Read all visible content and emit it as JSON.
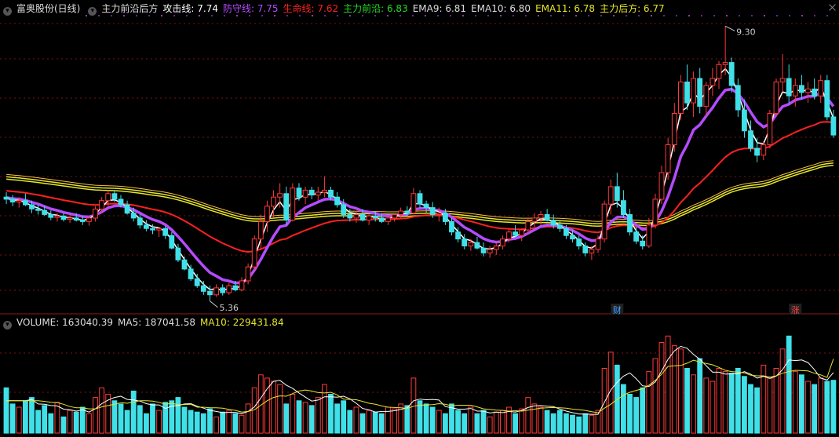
{
  "header": {
    "stock": "富奥股份(日线)",
    "indicator_name": "主力前沿后方",
    "lines": [
      {
        "label": "攻击线: ",
        "value": "7.74",
        "color": "#ffffff"
      },
      {
        "label": "防守线: ",
        "value": "7.75",
        "color": "#b44cff"
      },
      {
        "label": "生命线: ",
        "value": "7.62",
        "color": "#ff2020"
      },
      {
        "label": "主力前沿: ",
        "value": "6.83",
        "color": "#22dd22"
      },
      {
        "label": "EMA9: ",
        "value": "6.81",
        "color": "#dddddd"
      },
      {
        "label": "EMA10: ",
        "value": "6.80",
        "color": "#dddddd"
      },
      {
        "label": "EMA11: ",
        "value": "6.78",
        "color": "#e6e62e"
      },
      {
        "label": "主力后方: ",
        "value": "6.77",
        "color": "#e6e62e"
      }
    ]
  },
  "volume_header": {
    "volume_label": "VOLUME: ",
    "volume_value": "163040.39",
    "ma5_label": "MA5: ",
    "ma5_value": "187041.58",
    "ma10_label": "MA10: ",
    "ma10_value": "229431.84"
  },
  "annotations": {
    "high": "9.30",
    "low": "5.36",
    "marker_cai": "财",
    "marker_zhang": "涨"
  },
  "colors": {
    "up": "#ff3a3a",
    "down": "#40e0e8",
    "attack": "#ffffff",
    "defense": "#b44cff",
    "life": "#ff2020",
    "rear": "#e6e62e",
    "grid": "#7a1414"
  },
  "chart_data": {
    "type": "candlestick",
    "ylim": [
      5.2,
      9.45
    ],
    "high": 9.3,
    "low": 5.36,
    "candles": [
      [
        6.85,
        6.92,
        6.75,
        6.82
      ],
      [
        6.82,
        6.88,
        6.72,
        6.78
      ],
      [
        6.78,
        6.85,
        6.7,
        6.8
      ],
      [
        6.8,
        6.9,
        6.72,
        6.74
      ],
      [
        6.74,
        6.8,
        6.62,
        6.68
      ],
      [
        6.68,
        6.74,
        6.6,
        6.66
      ],
      [
        6.66,
        6.72,
        6.58,
        6.6
      ],
      [
        6.6,
        6.66,
        6.52,
        6.56
      ],
      [
        6.56,
        6.62,
        6.5,
        6.58
      ],
      [
        6.58,
        6.62,
        6.5,
        6.53
      ],
      [
        6.53,
        6.6,
        6.48,
        6.55
      ],
      [
        6.55,
        6.62,
        6.5,
        6.52
      ],
      [
        6.52,
        6.58,
        6.45,
        6.5
      ],
      [
        6.5,
        6.58,
        6.44,
        6.55
      ],
      [
        6.55,
        6.72,
        6.5,
        6.68
      ],
      [
        6.68,
        6.85,
        6.62,
        6.8
      ],
      [
        6.8,
        6.95,
        6.72,
        6.9
      ],
      [
        6.9,
        6.95,
        6.78,
        6.82
      ],
      [
        6.82,
        6.88,
        6.7,
        6.74
      ],
      [
        6.74,
        6.8,
        6.6,
        6.62
      ],
      [
        6.62,
        6.7,
        6.5,
        6.55
      ],
      [
        6.55,
        6.6,
        6.4,
        6.45
      ],
      [
        6.45,
        6.52,
        6.36,
        6.4
      ],
      [
        6.4,
        6.46,
        6.32,
        6.38
      ],
      [
        6.38,
        6.42,
        6.28,
        6.4
      ],
      [
        6.4,
        6.44,
        6.25,
        6.3
      ],
      [
        6.3,
        6.35,
        6.1,
        6.12
      ],
      [
        6.12,
        6.18,
        5.92,
        5.95
      ],
      [
        5.95,
        6.0,
        5.8,
        5.82
      ],
      [
        5.82,
        5.88,
        5.65,
        5.68
      ],
      [
        5.68,
        5.75,
        5.55,
        5.58
      ],
      [
        5.58,
        5.65,
        5.45,
        5.5
      ],
      [
        5.5,
        5.58,
        5.36,
        5.45
      ],
      [
        5.45,
        5.6,
        5.42,
        5.55
      ],
      [
        5.55,
        5.6,
        5.44,
        5.48
      ],
      [
        5.48,
        5.62,
        5.45,
        5.58
      ],
      [
        5.58,
        5.65,
        5.5,
        5.52
      ],
      [
        5.52,
        5.7,
        5.5,
        5.65
      ],
      [
        5.65,
        5.9,
        5.6,
        5.85
      ],
      [
        5.85,
        6.3,
        5.8,
        6.25
      ],
      [
        6.25,
        6.6,
        6.1,
        6.5
      ],
      [
        6.5,
        6.8,
        6.35,
        6.72
      ],
      [
        6.72,
        6.95,
        6.55,
        6.85
      ],
      [
        6.85,
        7.05,
        6.7,
        6.9
      ],
      [
        6.9,
        7.0,
        6.45,
        6.52
      ],
      [
        6.52,
        7.05,
        6.5,
        6.98
      ],
      [
        6.98,
        7.05,
        6.8,
        6.85
      ],
      [
        6.85,
        7.0,
        6.75,
        6.95
      ],
      [
        6.95,
        7.0,
        6.82,
        6.88
      ],
      [
        6.88,
        7.0,
        6.8,
        6.92
      ],
      [
        6.92,
        7.15,
        6.85,
        6.95
      ],
      [
        6.95,
        7.0,
        6.8,
        6.85
      ],
      [
        6.85,
        6.92,
        6.7,
        6.74
      ],
      [
        6.74,
        6.82,
        6.55,
        6.6
      ],
      [
        6.6,
        6.68,
        6.5,
        6.55
      ],
      [
        6.55,
        6.65,
        6.48,
        6.6
      ],
      [
        6.6,
        6.68,
        6.5,
        6.52
      ],
      [
        6.52,
        6.6,
        6.45,
        6.58
      ],
      [
        6.58,
        6.65,
        6.5,
        6.55
      ],
      [
        6.55,
        6.62,
        6.48,
        6.5
      ],
      [
        6.5,
        6.58,
        6.45,
        6.55
      ],
      [
        6.55,
        6.62,
        6.5,
        6.6
      ],
      [
        6.6,
        6.7,
        6.55,
        6.65
      ],
      [
        6.65,
        6.72,
        6.58,
        6.62
      ],
      [
        6.62,
        6.98,
        6.6,
        6.9
      ],
      [
        6.9,
        6.95,
        6.7,
        6.75
      ],
      [
        6.75,
        6.8,
        6.62,
        6.7
      ],
      [
        6.7,
        6.78,
        6.55,
        6.6
      ],
      [
        6.6,
        6.7,
        6.5,
        6.62
      ],
      [
        6.62,
        6.68,
        6.45,
        6.5
      ],
      [
        6.5,
        6.55,
        6.3,
        6.35
      ],
      [
        6.35,
        6.42,
        6.2,
        6.25
      ],
      [
        6.25,
        6.32,
        6.1,
        6.15
      ],
      [
        6.15,
        6.25,
        6.08,
        6.2
      ],
      [
        6.2,
        6.28,
        6.1,
        6.12
      ],
      [
        6.12,
        6.2,
        6.0,
        6.05
      ],
      [
        6.05,
        6.15,
        5.98,
        6.1
      ],
      [
        6.1,
        6.2,
        6.02,
        6.15
      ],
      [
        6.15,
        6.3,
        6.1,
        6.25
      ],
      [
        6.25,
        6.4,
        6.2,
        6.35
      ],
      [
        6.35,
        6.45,
        6.28,
        6.3
      ],
      [
        6.3,
        6.4,
        6.22,
        6.38
      ],
      [
        6.38,
        6.55,
        6.32,
        6.5
      ],
      [
        6.5,
        6.62,
        6.42,
        6.55
      ],
      [
        6.55,
        6.65,
        6.45,
        6.6
      ],
      [
        6.6,
        6.68,
        6.5,
        6.52
      ],
      [
        6.52,
        6.6,
        6.4,
        6.45
      ],
      [
        6.45,
        6.52,
        6.35,
        6.4
      ],
      [
        6.4,
        6.45,
        6.25,
        6.3
      ],
      [
        6.3,
        6.38,
        6.2,
        6.25
      ],
      [
        6.25,
        6.3,
        6.1,
        6.15
      ],
      [
        6.15,
        6.2,
        6.0,
        6.05
      ],
      [
        6.05,
        6.15,
        5.95,
        6.1
      ],
      [
        6.1,
        6.3,
        6.05,
        6.25
      ],
      [
        6.25,
        6.8,
        6.2,
        6.75
      ],
      [
        6.75,
        7.1,
        6.6,
        7.0
      ],
      [
        7.0,
        7.2,
        6.7,
        6.8
      ],
      [
        6.8,
        6.95,
        6.55,
        6.6
      ],
      [
        6.6,
        6.68,
        6.3,
        6.35
      ],
      [
        6.35,
        6.42,
        6.18,
        6.22
      ],
      [
        6.22,
        6.3,
        6.1,
        6.15
      ],
      [
        6.15,
        6.55,
        6.12,
        6.45
      ],
      [
        6.45,
        6.9,
        6.4,
        6.82
      ],
      [
        6.82,
        7.3,
        6.75,
        7.2
      ],
      [
        7.2,
        7.7,
        7.1,
        7.6
      ],
      [
        7.6,
        8.2,
        7.5,
        8.05
      ],
      [
        8.05,
        8.6,
        7.95,
        8.5
      ],
      [
        8.5,
        8.75,
        8.1,
        8.2
      ],
      [
        8.2,
        8.65,
        8.0,
        8.55
      ],
      [
        8.55,
        8.7,
        8.05,
        8.15
      ],
      [
        8.15,
        8.5,
        8.0,
        8.45
      ],
      [
        8.45,
        8.7,
        8.3,
        8.55
      ],
      [
        8.55,
        8.8,
        8.4,
        8.75
      ],
      [
        8.75,
        9.3,
        8.6,
        8.78
      ],
      [
        8.78,
        8.85,
        8.35,
        8.45
      ],
      [
        8.45,
        8.55,
        8.0,
        8.1
      ],
      [
        8.1,
        8.25,
        7.7,
        7.8
      ],
      [
        7.8,
        7.95,
        7.5,
        7.55
      ],
      [
        7.55,
        7.7,
        7.35,
        7.45
      ],
      [
        7.45,
        7.65,
        7.38,
        7.6
      ],
      [
        7.6,
        8.1,
        7.55,
        8.05
      ],
      [
        8.05,
        8.55,
        8.0,
        8.5
      ],
      [
        8.5,
        8.9,
        8.35,
        8.55
      ],
      [
        8.55,
        8.75,
        8.2,
        8.3
      ],
      [
        8.3,
        8.55,
        8.15,
        8.45
      ],
      [
        8.45,
        8.6,
        8.25,
        8.35
      ],
      [
        8.35,
        8.5,
        8.2,
        8.4
      ],
      [
        8.4,
        8.55,
        8.25,
        8.3
      ],
      [
        8.3,
        8.6,
        8.2,
        8.52
      ],
      [
        8.52,
        8.6,
        7.95,
        8.0
      ],
      [
        8.0,
        8.1,
        7.7,
        7.74
      ]
    ],
    "volume": {
      "ylim": [
        0,
        320000
      ],
      "values": [
        140000,
        90000,
        80000,
        100000,
        110000,
        70000,
        85000,
        60000,
        95000,
        50000,
        70000,
        65000,
        80000,
        60000,
        110000,
        140000,
        120000,
        100000,
        90000,
        70000,
        130000,
        85000,
        60000,
        90000,
        70000,
        95000,
        100000,
        110000,
        80000,
        70000,
        65000,
        60000,
        75000,
        50000,
        65000,
        70000,
        60000,
        55000,
        90000,
        140000,
        180000,
        170000,
        160000,
        150000,
        90000,
        120000,
        100000,
        95000,
        85000,
        110000,
        150000,
        120000,
        90000,
        100000,
        70000,
        80000,
        60000,
        70000,
        65000,
        60000,
        80000,
        75000,
        90000,
        85000,
        170000,
        100000,
        90000,
        80000,
        70000,
        60000,
        90000,
        70000,
        60000,
        80000,
        60000,
        70000,
        50000,
        65000,
        70000,
        80000,
        60000,
        75000,
        110000,
        90000,
        80000,
        70000,
        60000,
        70000,
        60000,
        55000,
        50000,
        60000,
        55000,
        70000,
        200000,
        250000,
        210000,
        150000,
        120000,
        110000,
        140000,
        190000,
        230000,
        280000,
        300000,
        270000,
        260000,
        200000,
        180000,
        230000,
        170000,
        160000,
        200000,
        190000,
        185000,
        200000,
        175000,
        150000,
        140000,
        210000,
        170000,
        200000,
        260000,
        300000,
        190000,
        180000,
        160000,
        150000,
        170000,
        160000,
        163040
      ],
      "ma5": [
        100000,
        100000,
        100000,
        100000,
        104000,
        90000,
        89000,
        85000,
        84000,
        74000,
        72000,
        68000,
        72000,
        65000,
        75000,
        91000,
        102000,
        110000,
        114000,
        104000,
        102000,
        99000,
        91000,
        87000,
        87000,
        76000,
        83000,
        85000,
        90000,
        91000,
        83000,
        77000,
        70000,
        67000,
        63000,
        64000,
        64000,
        60000,
        67000,
        81000,
        108000,
        137000,
        160000,
        163000,
        148000,
        138000,
        124000,
        111000,
        99000,
        102000,
        112000,
        112000,
        111000,
        114000,
        106000,
        92000,
        76000,
        72000,
        65000,
        67000,
        67000,
        69000,
        73000,
        78000,
        100000,
        105000,
        103000,
        104000,
        102000,
        82000,
        78000,
        74000,
        74000,
        76000,
        68000,
        68000,
        62000,
        65000,
        63000,
        67000,
        65000,
        70000,
        79000,
        84000,
        85000,
        83000,
        82000,
        74000,
        68000,
        63000,
        59000,
        59000,
        58000,
        58000,
        95000,
        133000,
        157000,
        176000,
        186000,
        168000,
        146000,
        144000,
        158000,
        192000,
        228000,
        254000,
        268000,
        262000,
        243000,
        228000,
        208000,
        188000,
        188000,
        182000,
        183000,
        183000,
        190000,
        182000,
        170000,
        175000,
        169000,
        176000,
        196000,
        226000,
        224000,
        226000,
        218000,
        196000,
        170000,
        164000,
        187042
      ],
      "ma10": [
        100000,
        100000,
        100000,
        100000,
        100000,
        100000,
        98000,
        95000,
        94000,
        89000,
        82000,
        78000,
        78000,
        75000,
        75000,
        81000,
        85000,
        89000,
        94000,
        92000,
        96000,
        100000,
        100000,
        99000,
        95000,
        89000,
        92000,
        88000,
        88000,
        89000,
        80000,
        80000,
        78000,
        78000,
        77000,
        73000,
        70000,
        65000,
        67000,
        72000,
        86000,
        100000,
        110000,
        115000,
        114000,
        122000,
        130000,
        133000,
        130000,
        125000,
        124000,
        126000,
        118000,
        105000,
        104000,
        103000,
        98000,
        92000,
        89000,
        84000,
        80000,
        79000,
        78000,
        76000,
        83000,
        86000,
        87000,
        88000,
        91000,
        89000,
        84000,
        86000,
        86000,
        86000,
        81000,
        75000,
        73000,
        71000,
        70000,
        68000,
        69000,
        68000,
        71000,
        74000,
        77000,
        78000,
        79000,
        78000,
        77000,
        74000,
        72000,
        70000,
        66000,
        63000,
        77000,
        89000,
        104000,
        117000,
        126000,
        132000,
        137000,
        148000,
        163000,
        182000,
        206000,
        208000,
        209000,
        216000,
        225000,
        220000,
        215000,
        211000,
        203000,
        194000,
        190000,
        188000,
        186000,
        179000,
        177000,
        177000,
        173000,
        177000,
        185000,
        190000,
        194000,
        193000,
        192000,
        185000,
        180000,
        172000,
        229432
      ]
    }
  }
}
